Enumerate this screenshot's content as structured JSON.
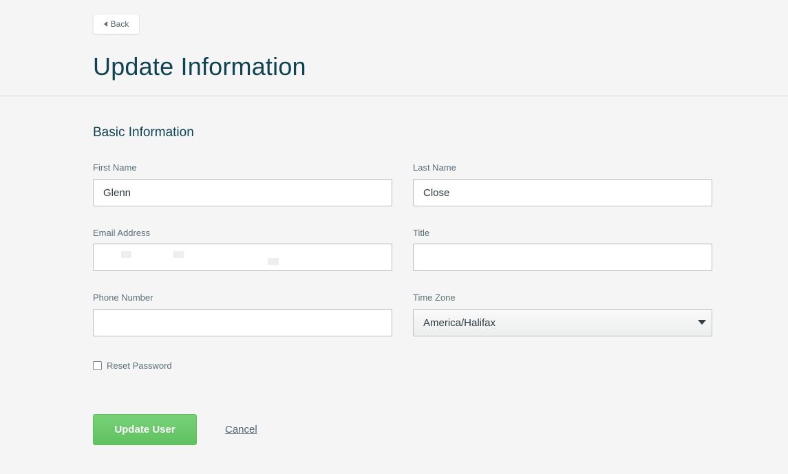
{
  "header": {
    "back_label": "Back",
    "title": "Update Information"
  },
  "form": {
    "section_title": "Basic Information",
    "first_name": {
      "label": "First Name",
      "value": "Glenn"
    },
    "last_name": {
      "label": "Last Name",
      "value": "Close"
    },
    "email": {
      "label": "Email Address",
      "value": ""
    },
    "title": {
      "label": "Title",
      "value": ""
    },
    "phone": {
      "label": "Phone Number",
      "value": ""
    },
    "time_zone": {
      "label": "Time Zone",
      "value": "America/Halifax"
    },
    "reset_password": {
      "label": "Reset Password",
      "checked": false
    }
  },
  "actions": {
    "submit_label": "Update User",
    "cancel_label": "Cancel"
  },
  "colors": {
    "heading": "#0f4352",
    "accent_green": "#66c566",
    "background": "#f4f5f4"
  }
}
